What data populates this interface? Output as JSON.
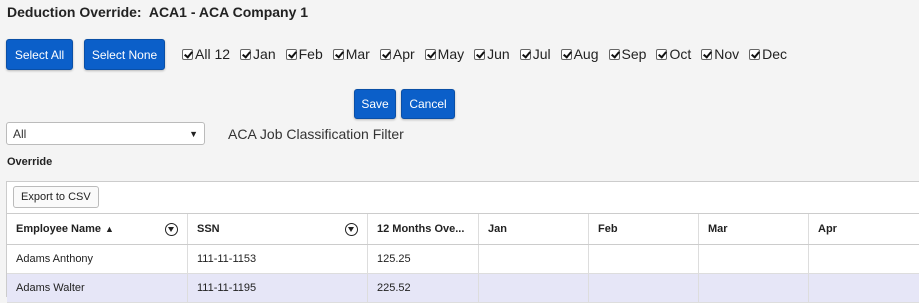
{
  "title": "Deduction Override:  ACA1 - ACA Company 1",
  "buttons": {
    "select_all": "Select All",
    "select_none": "Select None",
    "save": "Save",
    "cancel": "Cancel"
  },
  "months": [
    {
      "label": "All 12",
      "checked": true
    },
    {
      "label": "Jan",
      "checked": true
    },
    {
      "label": "Feb",
      "checked": true
    },
    {
      "label": "Mar",
      "checked": true
    },
    {
      "label": "Apr",
      "checked": true
    },
    {
      "label": "May",
      "checked": true
    },
    {
      "label": "Jun",
      "checked": true
    },
    {
      "label": "Jul",
      "checked": true
    },
    {
      "label": "Aug",
      "checked": true
    },
    {
      "label": "Sep",
      "checked": true
    },
    {
      "label": "Oct",
      "checked": true
    },
    {
      "label": "Nov",
      "checked": true
    },
    {
      "label": "Dec",
      "checked": true
    }
  ],
  "filter": {
    "selected": "All",
    "label": "ACA Job Classification Filter"
  },
  "section_label": "Override",
  "grid": {
    "export_label": "Export to CSV",
    "columns": [
      "Employee Name",
      "SSN",
      "12 Months Ove...",
      "Jan",
      "Feb",
      "Mar",
      "Apr"
    ],
    "sort_indicator": "▲",
    "rows": [
      [
        "Adams Anthony",
        "111-11-1153",
        "125.25",
        "",
        "",
        "",
        ""
      ],
      [
        "Adams Walter",
        "111-11-1195",
        "225.52",
        "",
        "",
        "",
        ""
      ]
    ]
  },
  "colors": {
    "button_blue": "#0b5fc9",
    "selected_row": "#e6e6f7"
  },
  "icons": {
    "column_filter": "filter-funnel-icon",
    "dropdown": "chevron-down-icon",
    "sort": "sort-ascending-icon",
    "checkbox": "checkbox-checked-icon"
  }
}
